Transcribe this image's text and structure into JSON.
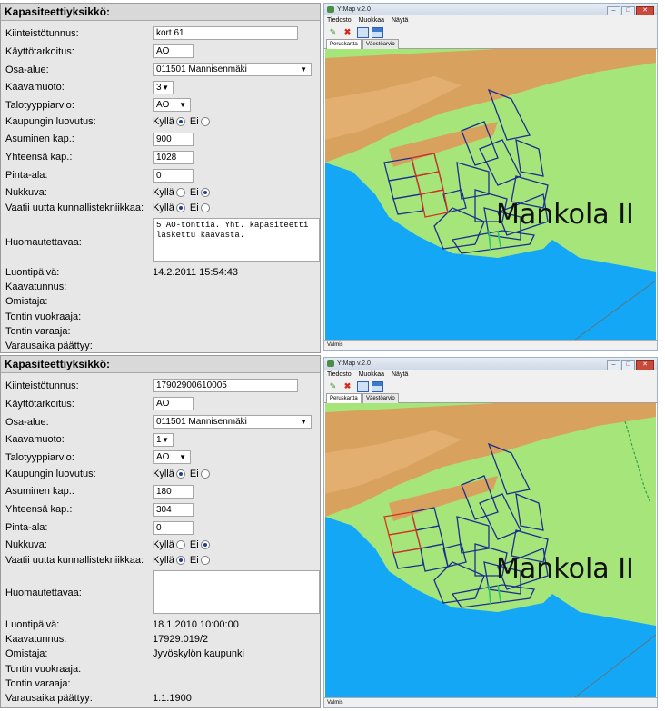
{
  "form_labels": {
    "title": "Kapasiteettiyksikkö:",
    "kiinteistotunnus": "Kiinteistötunnus:",
    "kayttotarkoitus": "Käyttötarkoitus:",
    "osa_alue": "Osa-alue:",
    "kaavamuoto": "Kaavamuoto:",
    "talotyyppiarvio": "Talotyyppiarvio:",
    "kaupungin_luovutus": "Kaupungin luovutus:",
    "asuminen_kap": "Asuminen kap.:",
    "yhteensa_kap": "Yhteensä kap.:",
    "pinta_ala": "Pinta-ala:",
    "nukkuva": "Nukkuva:",
    "vaatii": "Vaatii uutta kunnallistekniikkaa:",
    "huomautettavaa": "Huomautettavaa:",
    "luontipaiva": "Luontipäivä:",
    "kaavatunnus": "Kaavatunnus:",
    "omistaja": "Omistaja:",
    "tontin_vuokraaja": "Tontin vuokraaja:",
    "tontin_varaaja": "Tontin varaaja:",
    "varausaika": "Varausaika päättyy:",
    "kylla": "Kyllä",
    "ei": "Ei"
  },
  "form1": {
    "kiinteistotunnus": "kort 61",
    "kayttotarkoitus": "AO",
    "osa_alue": "011501 Mannisenmäki",
    "kaavamuoto": "3",
    "talotyyppiarvio": "AO",
    "kaupungin_luovutus": "Kyllä",
    "asuminen_kap": "900",
    "yhteensa_kap": "1028",
    "pinta_ala": "0",
    "nukkuva": "Ei",
    "vaatii": "Ei",
    "huomautettavaa": "5 AO-tonttia. Yht. kapasiteetti\nlaskettu kaavasta.",
    "luontipaiva": "14.2.2011 15:54:43",
    "kaavatunnus": "",
    "omistaja": "",
    "tontin_vuokraaja": "",
    "tontin_varaaja": "",
    "varausaika": ""
  },
  "form2": {
    "kiinteistotunnus": "17902900610005",
    "kayttotarkoitus": "AO",
    "osa_alue": "011501 Mannisenmäki",
    "kaavamuoto": "1",
    "talotyyppiarvio": "AO",
    "kaupungin_luovutus": "Kyllä",
    "asuminen_kap": "180",
    "yhteensa_kap": "304",
    "pinta_ala": "0",
    "nukkuva": "Ei",
    "vaatii": "Kyllä",
    "huomautettavaa": "",
    "luontipaiva": "18.1.2010 10:00:00",
    "kaavatunnus": "17929:019/2",
    "omistaja": "Jyvöskylön kaupunki",
    "tontin_vuokraaja": "",
    "tontin_varaaja": "",
    "varausaika": "1.1.1900"
  },
  "app": {
    "title": "YtMap v.2.0",
    "menu": [
      "Tiedosto",
      "Muokkaa",
      "Näytä"
    ],
    "tabs": [
      "Peruskartta",
      "Väestöarvio"
    ],
    "status": "Valmis",
    "map_label": "Mankola II",
    "tools": [
      "pencil-icon",
      "delete-icon",
      "layer-icon",
      "window-icon"
    ]
  },
  "colors": {
    "water": "#14a7f5",
    "land": "#a6e57a",
    "urban": "#d9a15e",
    "plot_outline": "#1b2f8f",
    "plot_highlight": "#d7321f"
  }
}
